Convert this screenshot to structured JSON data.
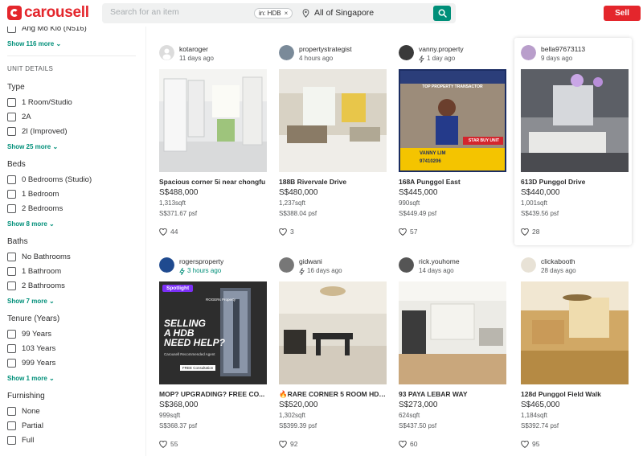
{
  "header": {
    "logo_text": "carousell",
    "search_placeholder": "Search for an item",
    "filter_chip": "in: HDB",
    "chip_close": "×",
    "location": "All of Singapore",
    "sell_label": "Sell"
  },
  "sidebar": {
    "top_item": "Ang Mo Kio (N516)",
    "top_more": "Show 116 more",
    "section_title": "UNIT DETAILS",
    "type": {
      "heading": "Type",
      "options": [
        "1 Room/Studio",
        "2A",
        "2I (Improved)"
      ],
      "more": "Show 25 more"
    },
    "beds": {
      "heading": "Beds",
      "options": [
        "0 Bedrooms (Studio)",
        "1 Bedroom",
        "2 Bedrooms"
      ],
      "more": "Show 8 more"
    },
    "baths": {
      "heading": "Baths",
      "options": [
        "No Bathrooms",
        "1 Bathroom",
        "2 Bathrooms"
      ],
      "more": "Show 7 more"
    },
    "tenure": {
      "heading": "Tenure (Years)",
      "options": [
        "99 Years",
        "103 Years",
        "999 Years"
      ],
      "more": "Show 1 more"
    },
    "furnishing": {
      "heading": "Furnishing",
      "options": [
        "None",
        "Partial",
        "Full"
      ]
    }
  },
  "listings": [
    {
      "seller": "kotaroger",
      "time": "11 days ago",
      "bumped": false,
      "title": "Spacious corner 5i near chongfu",
      "price": "S$488,000",
      "size": "1,313sqft",
      "psf": "S$371.67 psf",
      "likes": "44"
    },
    {
      "seller": "propertystrategist",
      "time": "4 hours ago",
      "bumped": false,
      "title": "188B Rivervale Drive",
      "price": "S$480,000",
      "size": "1,237sqft",
      "psf": "S$388.04 psf",
      "likes": "3"
    },
    {
      "seller": "vanny.property",
      "time": "1 day ago",
      "bumped": true,
      "title": "168A Punggol East",
      "price": "S$445,000",
      "size": "990sqft",
      "psf": "S$449.49 psf",
      "likes": "57",
      "photo_text": {
        "banner": "TOP PROPERTY TRANSACTOR",
        "badge": "STAR BUY UNIT",
        "agent": "VANNY LIM",
        "phone": "97410206"
      }
    },
    {
      "seller": "bella97673113",
      "time": "9 days ago",
      "bumped": false,
      "title": "613D Punggol Drive",
      "price": "S$440,000",
      "size": "1,001sqft",
      "psf": "S$439.56 psf",
      "likes": "28"
    },
    {
      "seller": "rogersproperty",
      "time": "3 hours ago",
      "bumped": true,
      "bumped_green": true,
      "title": "MOP? UPGRADING? FREE CO...",
      "price": "S$368,000",
      "size": "999sqft",
      "psf": "S$368.37 psf",
      "likes": "55",
      "photo_text": {
        "tag": "Spotlight",
        "brand": "ROGERs Property",
        "line1": "SELLING",
        "line2": "A HDB",
        "line3": "NEED HELP?",
        "sub": "Carousell Recommended Agent",
        "cta": "FREE Consultation"
      }
    },
    {
      "seller": "gidwani",
      "time": "16 days ago",
      "bumped": true,
      "title": "🔥RARE CORNER 5 ROOM HDB...",
      "price": "S$520,000",
      "size": "1,302sqft",
      "psf": "S$399.39 psf",
      "likes": "92"
    },
    {
      "seller": "rick.youhome",
      "time": "14 days ago",
      "bumped": false,
      "title": "93 PAYA LEBAR WAY",
      "price": "S$273,000",
      "size": "624sqft",
      "psf": "S$437.50 psf",
      "likes": "60"
    },
    {
      "seller": "clickabooth",
      "time": "28 days ago",
      "bumped": false,
      "title": "128d Punggol Field Walk",
      "price": "S$465,000",
      "size": "1,184sqft",
      "psf": "S$392.74 psf",
      "likes": "95"
    }
  ],
  "colors": {
    "brand": "#e4262c",
    "accent": "#008f79"
  }
}
